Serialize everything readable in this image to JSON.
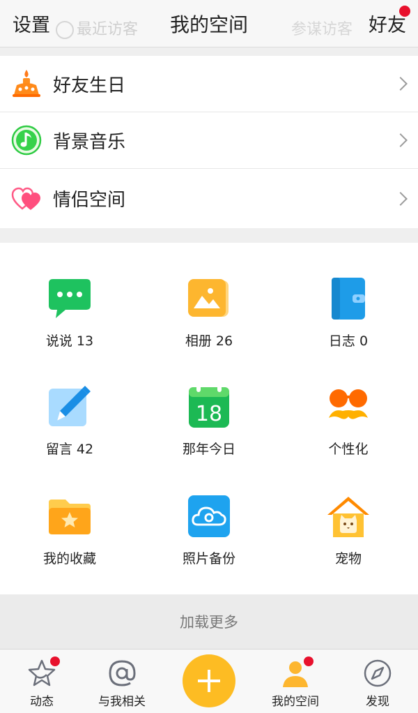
{
  "header": {
    "left": "设置",
    "title": "我的空间",
    "right": "好友",
    "ghost_left": "最近访客",
    "ghost_right": "参谋访客"
  },
  "list": [
    {
      "label": "好友生日",
      "icon": "birthday-cake-icon"
    },
    {
      "label": "背景音乐",
      "icon": "music-note-icon"
    },
    {
      "label": "情侣空间",
      "icon": "hearts-icon"
    }
  ],
  "grid": [
    {
      "label": "说说 13",
      "icon": "chat-bubble-icon"
    },
    {
      "label": "相册 26",
      "icon": "photo-album-icon"
    },
    {
      "label": "日志 0",
      "icon": "diary-icon"
    },
    {
      "label": "留言 42",
      "icon": "pen-icon"
    },
    {
      "label": "那年今日",
      "icon": "calendar-icon",
      "date_number": "18"
    },
    {
      "label": "个性化",
      "icon": "sunglasses-mustache-icon"
    },
    {
      "label": "我的收藏",
      "icon": "star-folder-icon"
    },
    {
      "label": "照片备份",
      "icon": "cloud-backup-icon"
    },
    {
      "label": "宠物",
      "icon": "pet-house-icon"
    }
  ],
  "load_more": "加载更多",
  "tabs": [
    {
      "label": "动态",
      "icon": "star-icon",
      "badge": true
    },
    {
      "label": "与我相关",
      "icon": "at-icon",
      "badge": false
    },
    {
      "label": "我的空间",
      "icon": "person-icon",
      "badge": true
    },
    {
      "label": "发现",
      "icon": "compass-icon",
      "badge": false
    }
  ],
  "colors": {
    "accent_yellow": "#fdbc23",
    "badge_red": "#e8112d",
    "chat_green": "#1ec25f",
    "album_orange": "#fdb62f",
    "diary_blue": "#1e9ce8",
    "calendar_green": "#1cb954"
  }
}
